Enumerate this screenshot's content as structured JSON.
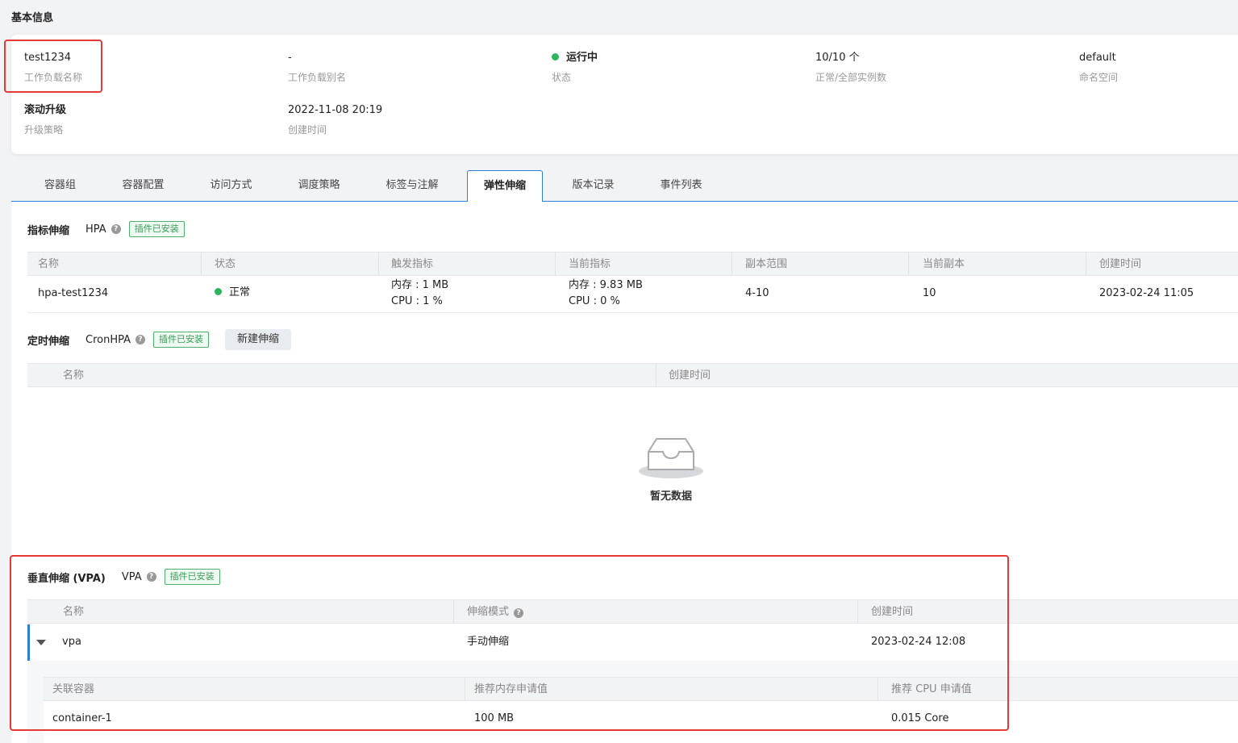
{
  "section_title": "基本信息",
  "info": {
    "name_value": "test1234",
    "name_label": "工作负载名称",
    "alias_value": "-",
    "alias_label": "工作负载别名",
    "status_value": "运行中",
    "status_label": "状态",
    "instances_value": "10/10 个",
    "instances_label": "正常/全部实例数",
    "namespace_value": "default",
    "namespace_label": "命名空间",
    "strategy_value": "滚动升级",
    "strategy_label": "升级策略",
    "created_value": "2022-11-08 20:19",
    "created_label": "创建时间"
  },
  "tabs": [
    "容器组",
    "容器配置",
    "访问方式",
    "调度策略",
    "标签与注解",
    "弹性伸缩",
    "版本记录",
    "事件列表"
  ],
  "active_tab": "弹性伸缩",
  "hpa": {
    "title": "指标伸缩",
    "name": "HPA",
    "tag": "插件已安装",
    "columns": [
      "名称",
      "状态",
      "触发指标",
      "当前指标",
      "副本范围",
      "当前副本",
      "创建时间"
    ],
    "row": {
      "name": "hpa-test1234",
      "status": "正常",
      "trigger_mem": "内存 : 1 MB",
      "trigger_cpu": "CPU : 1 %",
      "current_mem": "内存 : 9.83 MB",
      "current_cpu": "CPU : 0 %",
      "range": "4-10",
      "replicas": "10",
      "created": "2023-02-24 11:05"
    }
  },
  "cronhpa": {
    "title": "定时伸缩",
    "name": "CronHPA",
    "tag": "插件已安装",
    "button": "新建伸缩",
    "columns": [
      "名称",
      "创建时间"
    ],
    "empty_text": "暂无数据"
  },
  "vpa": {
    "title": "垂直伸缩 (VPA)",
    "name": "VPA",
    "tag": "插件已安装",
    "columns": [
      "名称",
      "伸缩模式",
      "创建时间"
    ],
    "row": {
      "name": "vpa",
      "mode": "手动伸缩",
      "created": "2023-02-24 12:08"
    },
    "inner_columns": [
      "关联容器",
      "推荐内存申请值",
      "推荐 CPU 申请值"
    ],
    "inner_row": {
      "container": "container-1",
      "memory": "100 MB",
      "cpu": "0.015 Core"
    }
  },
  "colors": {
    "accent": "#2a7fd4",
    "success": "#2db55d",
    "highlight": "#e53935"
  }
}
